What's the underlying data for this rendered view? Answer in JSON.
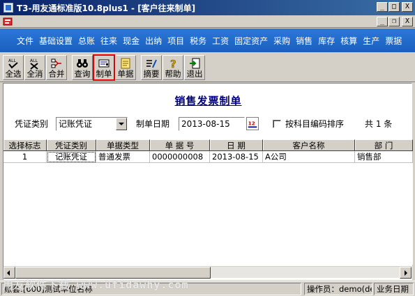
{
  "window": {
    "title": "T3-用友通标准版10.8plus1 - [客户往来制单]",
    "minimize_glyph": "_",
    "maximize_glyph": "□",
    "close_glyph": "X",
    "restore_glyph": "❐"
  },
  "menu": {
    "items": [
      "文件",
      "基础设置",
      "总账",
      "往来",
      "现金",
      "出纳",
      "项目",
      "税务",
      "工资",
      "固定资产",
      "采购",
      "销售",
      "库存",
      "核算",
      "生产",
      "票据"
    ]
  },
  "toolbar": {
    "buttons": [
      {
        "label": "全选",
        "icon": "select-all-icon"
      },
      {
        "label": "全消",
        "icon": "deselect-all-icon"
      },
      {
        "label": "合并",
        "icon": "merge-icon"
      },
      {
        "label": "查询",
        "icon": "binoculars-icon"
      },
      {
        "label": "制单",
        "icon": "make-voucher-icon"
      },
      {
        "label": "单据",
        "icon": "document-icon"
      },
      {
        "label": "摘要",
        "icon": "summary-icon"
      },
      {
        "label": "帮助",
        "icon": "help-icon"
      },
      {
        "label": "退出",
        "icon": "exit-icon"
      }
    ],
    "select_all_glyph": "ALL",
    "help_glyph": "?",
    "highlight_color": "#e00000"
  },
  "main": {
    "title": "销售发票制单",
    "voucher_type_label": "凭证类别",
    "voucher_type_value": "记账凭证",
    "date_label": "制单日期",
    "date_value": "2013-08-15",
    "calendar_glyph": "12",
    "sort_checkbox_label": "按科目编码排序",
    "count_text": "共 1 条"
  },
  "grid": {
    "headers": [
      "选择标志",
      "凭证类别",
      "单据类型",
      "单 据 号",
      "日  期",
      "客户名称",
      "部  门"
    ],
    "rows": [
      [
        "1",
        "记账凭证",
        "普通发票",
        "0000000008",
        "2013-08-15",
        "A公司",
        "销售部"
      ]
    ]
  },
  "statusbar": {
    "account": "账套:[600]测试单位名称",
    "operator": "操作员：demo(de",
    "business_date": "业务日期"
  },
  "watermark": "用友软件下载  www.ufidawhy.com"
}
